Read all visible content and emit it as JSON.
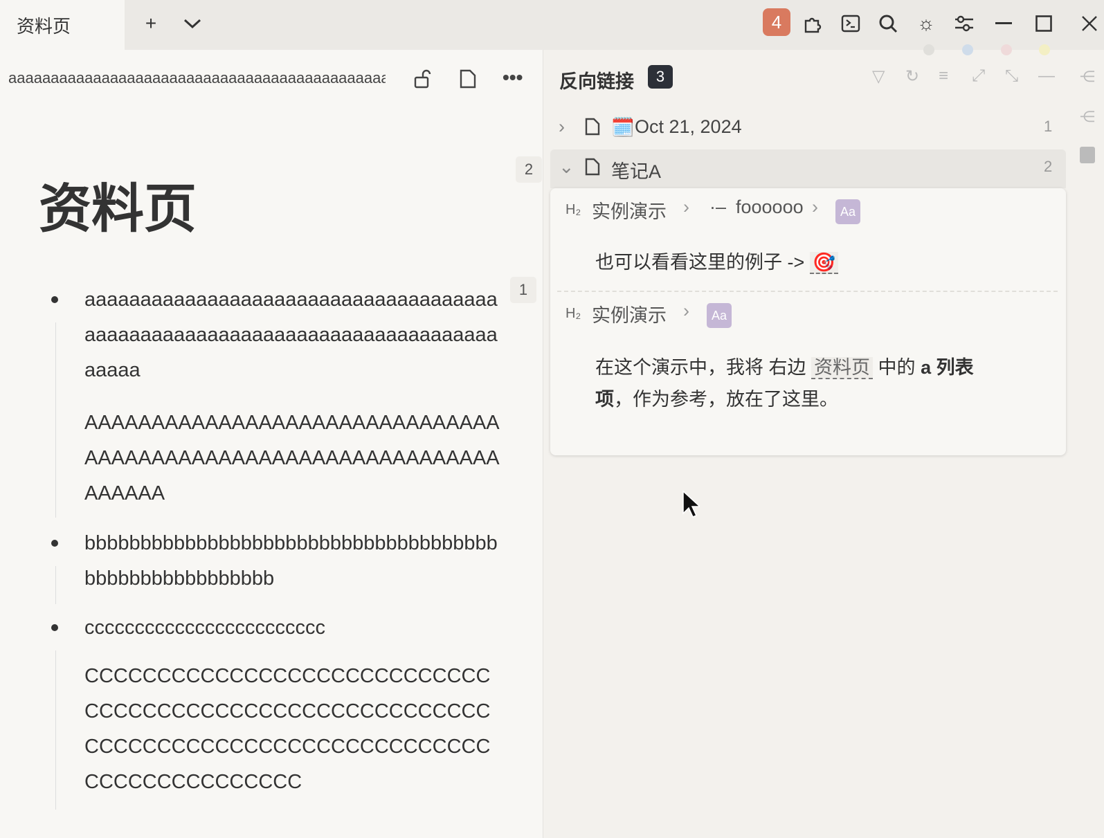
{
  "tab": {
    "title": "资料页",
    "add": "+",
    "dropdown": "⌄"
  },
  "toolbar": {
    "badge": "4",
    "icons": [
      "puzzle-icon",
      "terminal-icon",
      "search-icon",
      "sun-icon",
      "sliders-icon",
      "minimize-icon",
      "maximize-icon",
      "close-icon"
    ]
  },
  "dot_colors": [
    "#e0dfdb",
    "#cfdcea",
    "#efdada",
    "#f3efc4"
  ],
  "left": {
    "breadcrumb": "aaaaaaaaaaaaaaaaaaaaaaaaaaaaaaaaaaaaaaaaaaaaaaaaa",
    "title": "资料页",
    "title_count": "2",
    "item1_count": "1",
    "items": [
      {
        "text": "aaaaaaaaaaaaaaaaaaaaaaaaaaaaaaaaaaaaaaaaaaaaaaaaaaaaaaaaaaaaaaaaaaaaaaaaaaaaaaa",
        "sub": "AAAAAAAAAAAAAAAAAAAAAAAAAAAAAAAAAAAAAAAAAAAAAAAAAAAAAAAAAAAAAAAAAAAA"
      },
      {
        "text": "bbbbbbbbbbbbbbbbbbbbbbbbbbbbbbbbbbbbbbbbbbbbbbbbbbbbbb"
      },
      {
        "text": "cccccccccccccccccccccccc",
        "sub": "CCCCCCCCCCCCCCCCCCCCCCCCCCCCCCCCCCCCCCCCCCCCCCCCCCCCCCCCCCCCCCCCCCCCCCCCCCCCCCCCCCCCCCCCCCCCCCCCCCC"
      }
    ]
  },
  "backlinks": {
    "title": "反向链接",
    "count": "3",
    "docs": [
      {
        "icon": "🗓️",
        "name": "Oct 21, 2024",
        "count": "1"
      },
      {
        "name": "笔记A",
        "count": "2"
      }
    ],
    "entries": [
      {
        "heading": "H₂",
        "path": [
          "实例演示",
          "foooooo"
        ],
        "text": "也可以看看这里的例子 ->",
        "emoji": "🎯"
      },
      {
        "heading": "H₂",
        "path": [
          "实例演示"
        ],
        "text_before": "在这个演示中，我将 右边",
        "ref": "资料页",
        "text_mid": "中的",
        "bold": "a 列表项",
        "text_after": "，作为参考，放在了这里。"
      }
    ],
    "aa": "Aa"
  }
}
